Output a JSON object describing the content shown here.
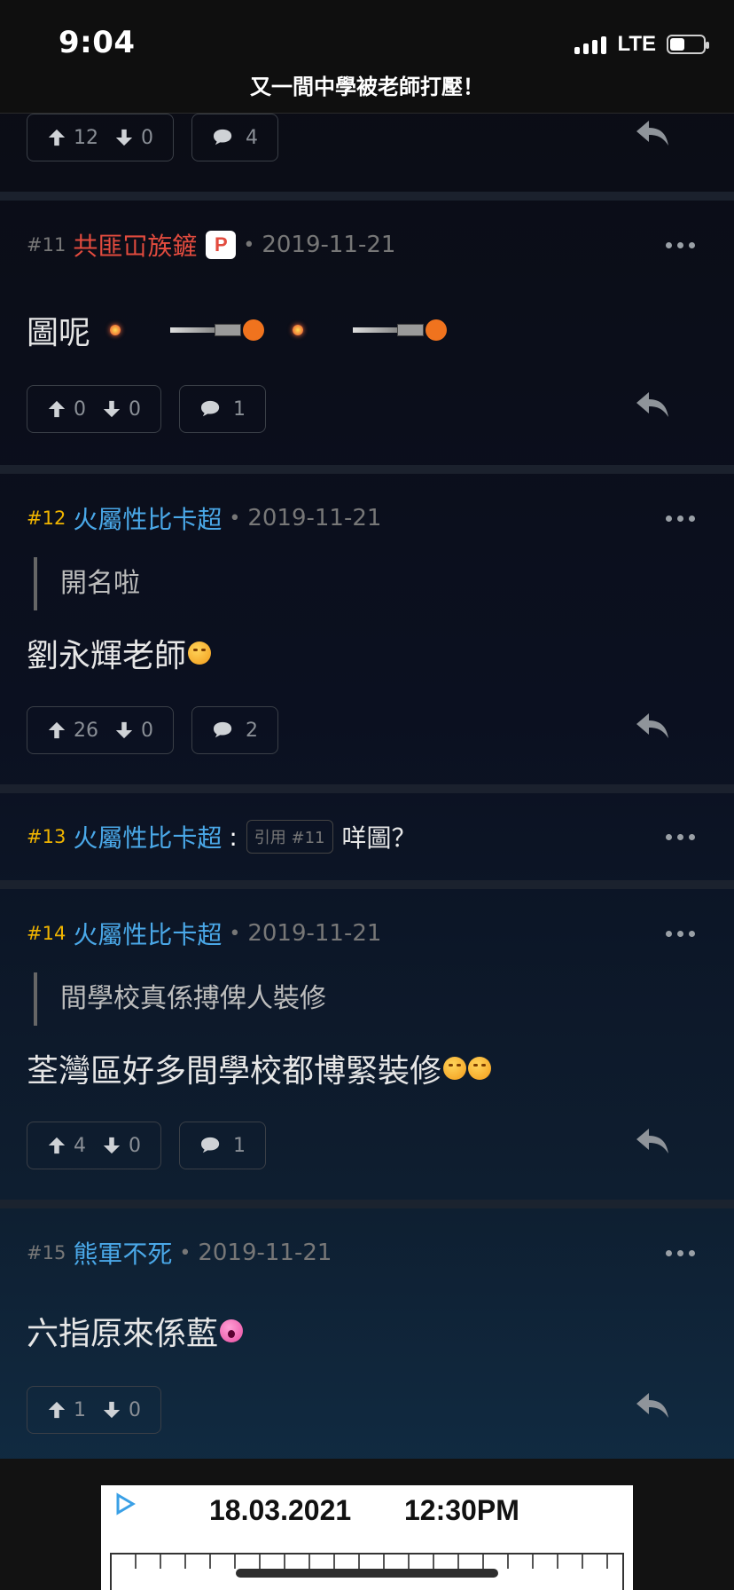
{
  "status_bar": {
    "time": "9:04",
    "network": "LTE"
  },
  "header": {
    "title": "又一間中學被老師打壓！"
  },
  "posts": [
    {
      "up": "12",
      "down": "0",
      "comments": "4"
    },
    {
      "floor": "#11",
      "username": "共匪冚族鏟",
      "badge": "P",
      "date": "2019-11-21",
      "content": "圖呢",
      "up": "0",
      "down": "0",
      "comments": "1"
    },
    {
      "floor": "#12",
      "username": "火屬性比卡超",
      "date": "2019-11-21",
      "quote": "開名啦",
      "content": "劉永輝老師",
      "up": "26",
      "down": "0",
      "comments": "2"
    },
    {
      "floor": "#13",
      "username": "火屬性比卡超",
      "quote_tag": "引用 #11",
      "content": "咩圖？"
    },
    {
      "floor": "#14",
      "username": "火屬性比卡超",
      "date": "2019-11-21",
      "quote": "間學校真係搏俾人裝修",
      "content": "荃灣區好多間學校都博緊裝修",
      "up": "4",
      "down": "0",
      "comments": "1"
    },
    {
      "floor": "#15",
      "username": "熊軍不死",
      "date": "2019-11-21",
      "content": "六指原來係藍",
      "up": "1",
      "down": "0"
    }
  ],
  "ad": {
    "date": "18.03.2021",
    "time": "12:30PM"
  },
  "colors": {
    "hot_floor": "#f0b400",
    "username": "#4aa8e8",
    "admin_name": "#e24b3e",
    "muted": "#777777"
  },
  "icons": [
    "arrow-up-icon",
    "arrow-down-icon",
    "comment-icon",
    "reply-icon",
    "more-icon",
    "ad-choices-icon"
  ]
}
